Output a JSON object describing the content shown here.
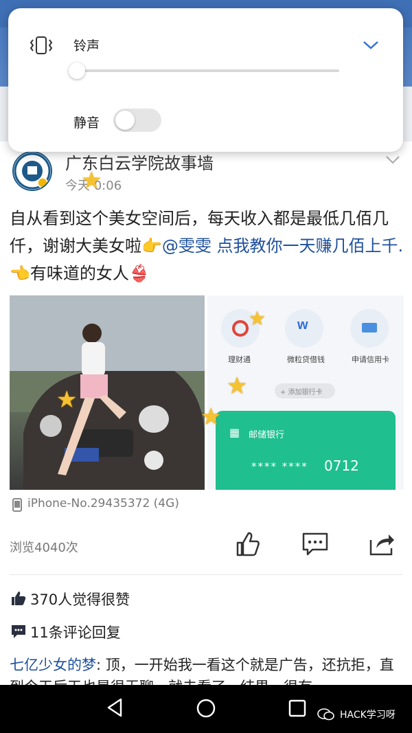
{
  "volume_panel": {
    "ringtone_label": "铃声",
    "mute_label": "静音",
    "ringtone_level": 0.0,
    "mute_on": false,
    "icons": {
      "vibrate": "vibrate-icon",
      "expand": "chevron-down-icon"
    }
  },
  "post": {
    "author": "广东白云学院故事墙",
    "time": "今天 0:06",
    "text_part1": "自从看到这个美女空间后，每天收入都是最低几佰几仟，谢谢大美女啦",
    "mention": "@雯雯 点我教你一天赚几佰上千.",
    "text_part2": "有味道的女人",
    "device": "iPhone-No.29435372 (4G)",
    "views": "浏览4040次",
    "likes": "370人觉得很赞",
    "comments": "11条评论回复",
    "comment_user": "七亿少女的梦",
    "comment_text": ": 顶，一开始我一看这个就是广告，还抗拒，直到今天后天也是很无聊，就去看了，结果，很有"
  },
  "bank_screen": {
    "apps": [
      "理财通",
      "微粒贷借钱",
      "申请信用卡"
    ],
    "add_card": "+ 添加银行卡",
    "bank_name": "邮储银行",
    "card_masked": "****  ****",
    "card_last4": "0712"
  },
  "watermark": "HACK学习呀",
  "colors": {
    "accent_blue": "#2f6fd6",
    "link_blue": "#1d4f9c",
    "bank_green": "#1fbf8f"
  }
}
